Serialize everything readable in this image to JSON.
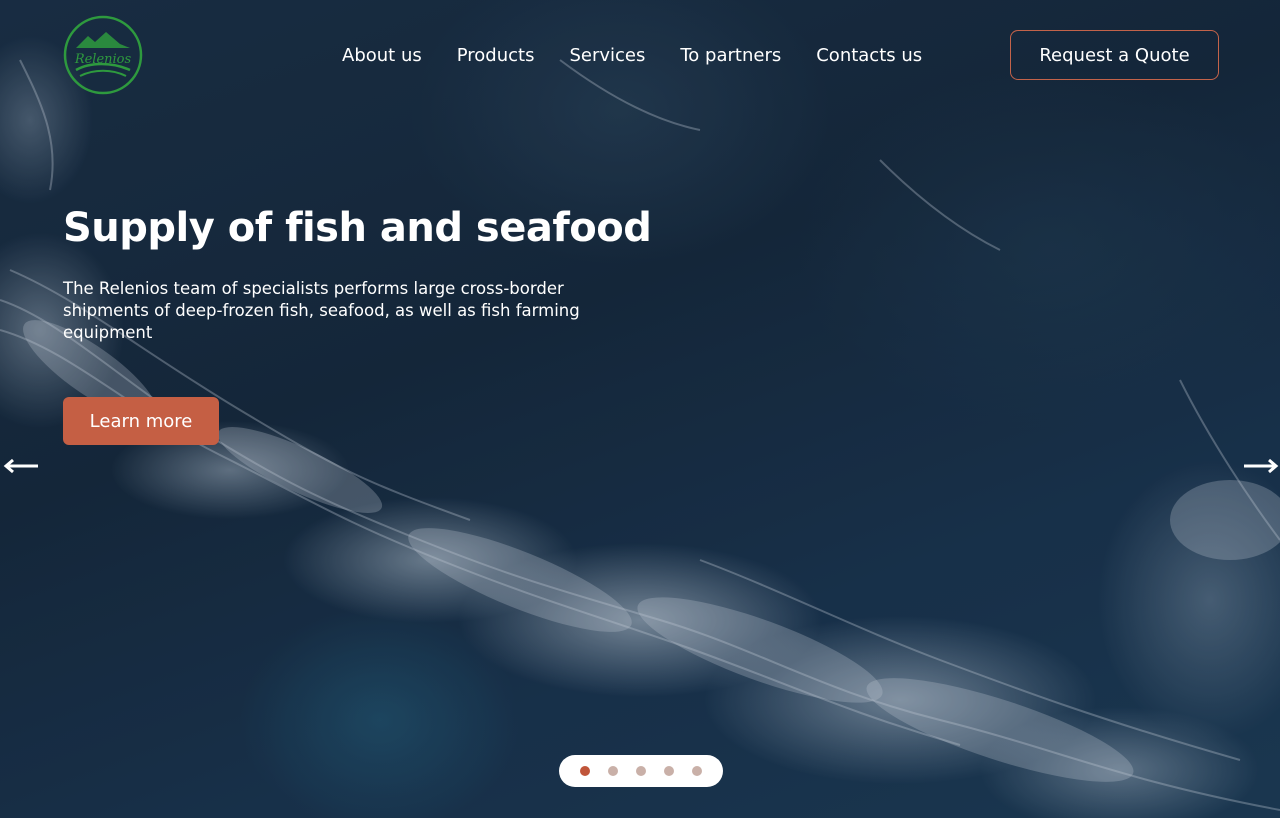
{
  "brand": {
    "logo_text": "Relenios",
    "logo_color": "#2e9a3e"
  },
  "nav": {
    "items": [
      {
        "label": "About us"
      },
      {
        "label": "Products"
      },
      {
        "label": "Services"
      },
      {
        "label": "To partners"
      },
      {
        "label": "Contacts us"
      }
    ]
  },
  "header": {
    "quote_label": "Request a Quote"
  },
  "hero": {
    "title": "Supply of fish and seafood",
    "text": "The Relenios team of specialists performs large cross-border shipments of deep-frozen fish, seafood, as well as fish farming equipment",
    "cta_label": "Learn more"
  },
  "carousel": {
    "slide_count": 5,
    "active_index": 0,
    "prev_icon": "arrow-left-icon",
    "next_icon": "arrow-right-icon"
  },
  "colors": {
    "accent": "#c55f44",
    "dot_inactive": "#c9b0a8",
    "dot_active": "#c0553a",
    "text": "#ffffff"
  }
}
